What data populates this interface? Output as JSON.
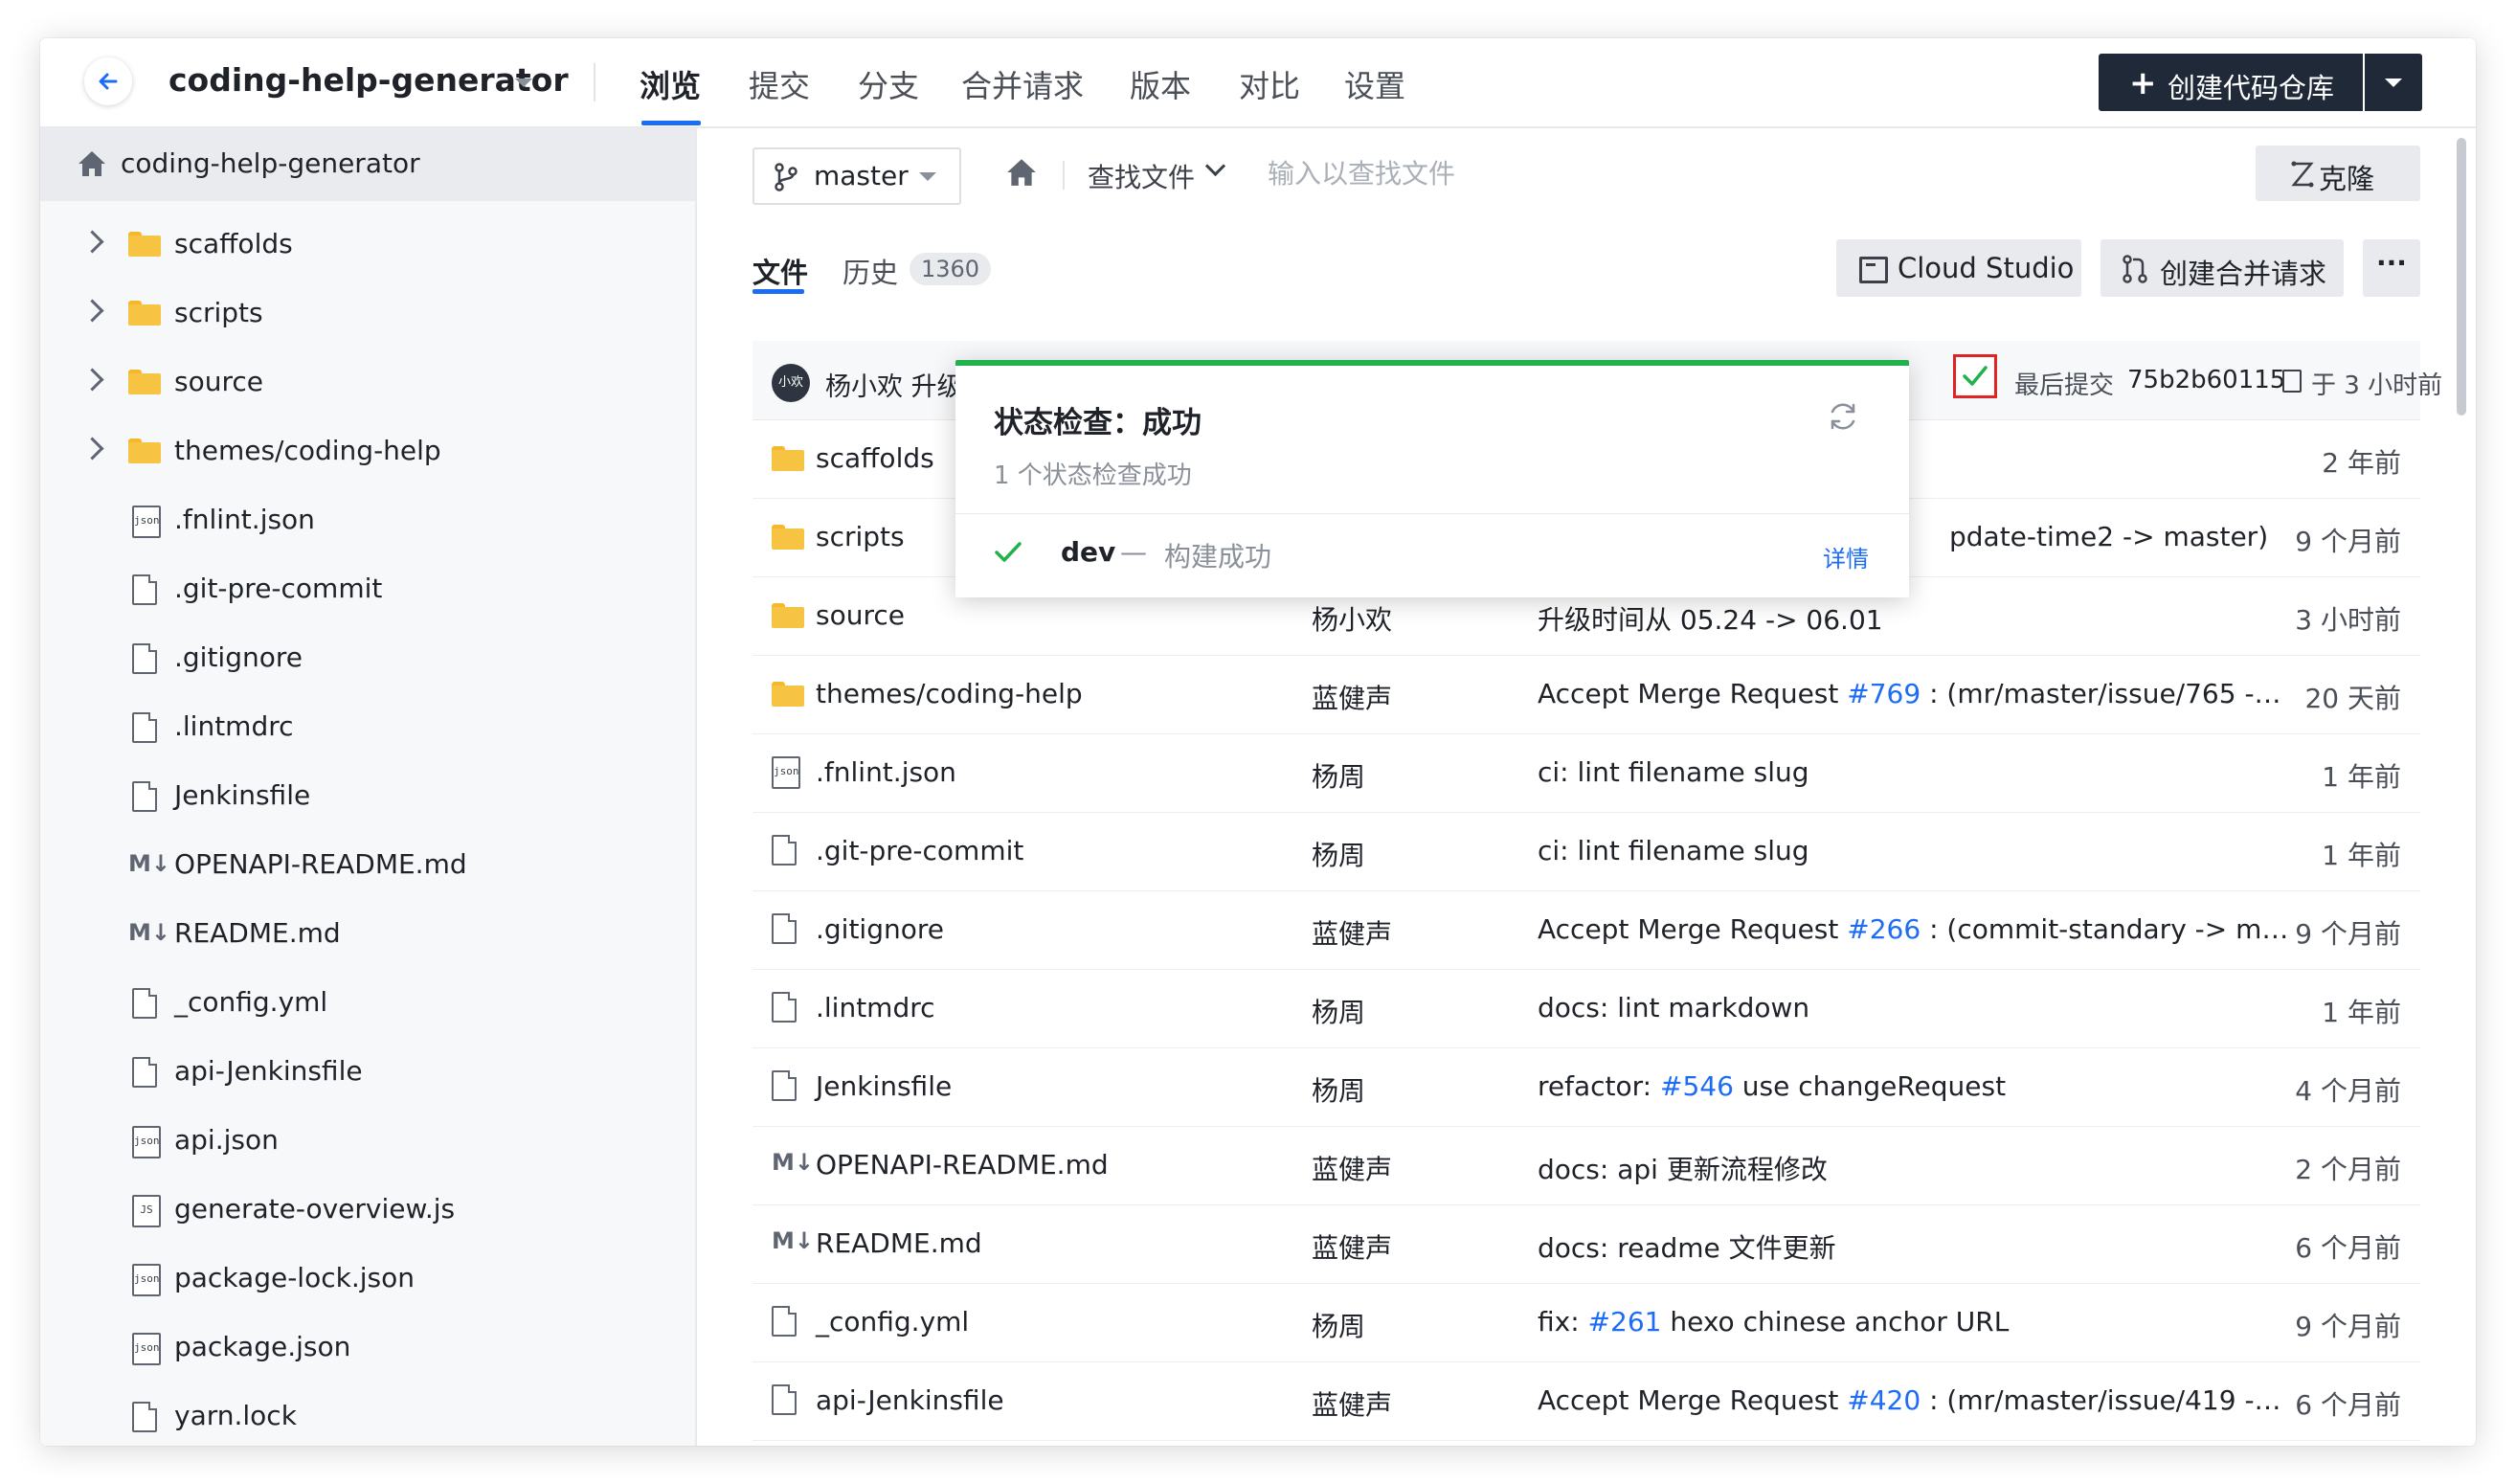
{
  "header": {
    "repo_name": "coding-help-generator",
    "nav": [
      "浏览",
      "提交",
      "分支",
      "合并请求",
      "版本",
      "对比",
      "设置"
    ],
    "active_nav": "浏览",
    "create_label": "创建代码仓库",
    "accent": "#1d6cf5",
    "dark_button": "#1f2937"
  },
  "sidebar": {
    "root": "coding-help-generator",
    "items": [
      {
        "label": "scaffolds",
        "type": "folder"
      },
      {
        "label": "scripts",
        "type": "folder"
      },
      {
        "label": "source",
        "type": "folder"
      },
      {
        "label": "themes/coding-help",
        "type": "folder"
      },
      {
        "label": ".fnlint.json",
        "type": "json"
      },
      {
        "label": ".git-pre-commit",
        "type": "file"
      },
      {
        "label": ".gitignore",
        "type": "file"
      },
      {
        "label": ".lintmdrc",
        "type": "file"
      },
      {
        "label": "Jenkinsfile",
        "type": "file"
      },
      {
        "label": "OPENAPI-README.md",
        "type": "md"
      },
      {
        "label": "README.md",
        "type": "md"
      },
      {
        "label": "_config.yml",
        "type": "file"
      },
      {
        "label": "api-Jenkinsfile",
        "type": "file"
      },
      {
        "label": "api.json",
        "type": "json"
      },
      {
        "label": "generate-overview.js",
        "type": "js"
      },
      {
        "label": "package-lock.json",
        "type": "json"
      },
      {
        "label": "package.json",
        "type": "json"
      },
      {
        "label": "yarn.lock",
        "type": "file"
      }
    ]
  },
  "toolbar": {
    "branch": "master",
    "find_label": "查找文件",
    "find_placeholder": "输入以查找文件",
    "clone_label": "克隆",
    "tab_files": "文件",
    "tab_history": "历史",
    "history_count": "1360",
    "studio_label": "Cloud Studio",
    "mr_label": "创建合并请求",
    "more_label": "···"
  },
  "commit": {
    "avatar_text": "小欢",
    "author_partial": "杨小欢 升级",
    "last_commit_label": "最后提交",
    "hash": "75b2b60115",
    "time": "于 3 小时前",
    "status_color": "#22b14c"
  },
  "popup": {
    "title": "状态检查：成功",
    "subtitle": "1 个状态检查成功",
    "item_name": "dev",
    "item_dash": "—",
    "item_desc": "构建成功",
    "item_link": "详情"
  },
  "files": [
    {
      "name": "scaffolds",
      "type": "folder",
      "author": "",
      "msg_pre": "",
      "link": "",
      "msg_post": "",
      "time": "2 年前"
    },
    {
      "name": "scripts",
      "type": "folder",
      "author": "",
      "msg_pre": "pdate-time2 -> master)",
      "link": "",
      "msg_post": "",
      "time": "9 个月前"
    },
    {
      "name": "source",
      "type": "folder",
      "author": "杨小欢",
      "msg_pre": "升级时间从 05.24 -> 06.01",
      "link": "",
      "msg_post": "",
      "time": "3 小时前"
    },
    {
      "name": "themes/coding-help",
      "type": "folder",
      "author": "蓝健声",
      "msg_pre": "Accept Merge Request ",
      "link": "#769",
      "msg_post": " : (mr/master/issue/765 -…",
      "time": "20 天前"
    },
    {
      "name": ".fnlint.json",
      "type": "json",
      "author": "杨周",
      "msg_pre": "ci: lint filename slug",
      "link": "",
      "msg_post": "",
      "time": "1 年前"
    },
    {
      "name": ".git-pre-commit",
      "type": "file",
      "author": "杨周",
      "msg_pre": "ci: lint filename slug",
      "link": "",
      "msg_post": "",
      "time": "1 年前"
    },
    {
      "name": ".gitignore",
      "type": "file",
      "author": "蓝健声",
      "msg_pre": "Accept Merge Request ",
      "link": "#266",
      "msg_post": " : (commit-standary -> m…",
      "time": "9 个月前"
    },
    {
      "name": ".lintmdrc",
      "type": "file",
      "author": "杨周",
      "msg_pre": "docs: lint markdown",
      "link": "",
      "msg_post": "",
      "time": "1 年前"
    },
    {
      "name": "Jenkinsfile",
      "type": "file",
      "author": "杨周",
      "msg_pre": "refactor: ",
      "link": "#546",
      "msg_post": " use changeRequest",
      "time": "4 个月前"
    },
    {
      "name": "OPENAPI-README.md",
      "type": "md",
      "author": "蓝健声",
      "msg_pre": "docs: api 更新流程修改",
      "link": "",
      "msg_post": "",
      "time": "2 个月前"
    },
    {
      "name": "README.md",
      "type": "md",
      "author": "蓝健声",
      "msg_pre": "docs: readme 文件更新",
      "link": "",
      "msg_post": "",
      "time": "6 个月前"
    },
    {
      "name": "_config.yml",
      "type": "file",
      "author": "杨周",
      "msg_pre": "fix: ",
      "link": "#261",
      "msg_post": " hexo chinese anchor URL",
      "time": "9 个月前"
    },
    {
      "name": "api-Jenkinsfile",
      "type": "file",
      "author": "蓝健声",
      "msg_pre": "Accept Merge Request ",
      "link": "#420",
      "msg_post": " : (mr/master/issue/419 -…",
      "time": "6 个月前"
    }
  ],
  "icons": {
    "md": "M↓",
    "json": "json",
    "js": "JS"
  }
}
